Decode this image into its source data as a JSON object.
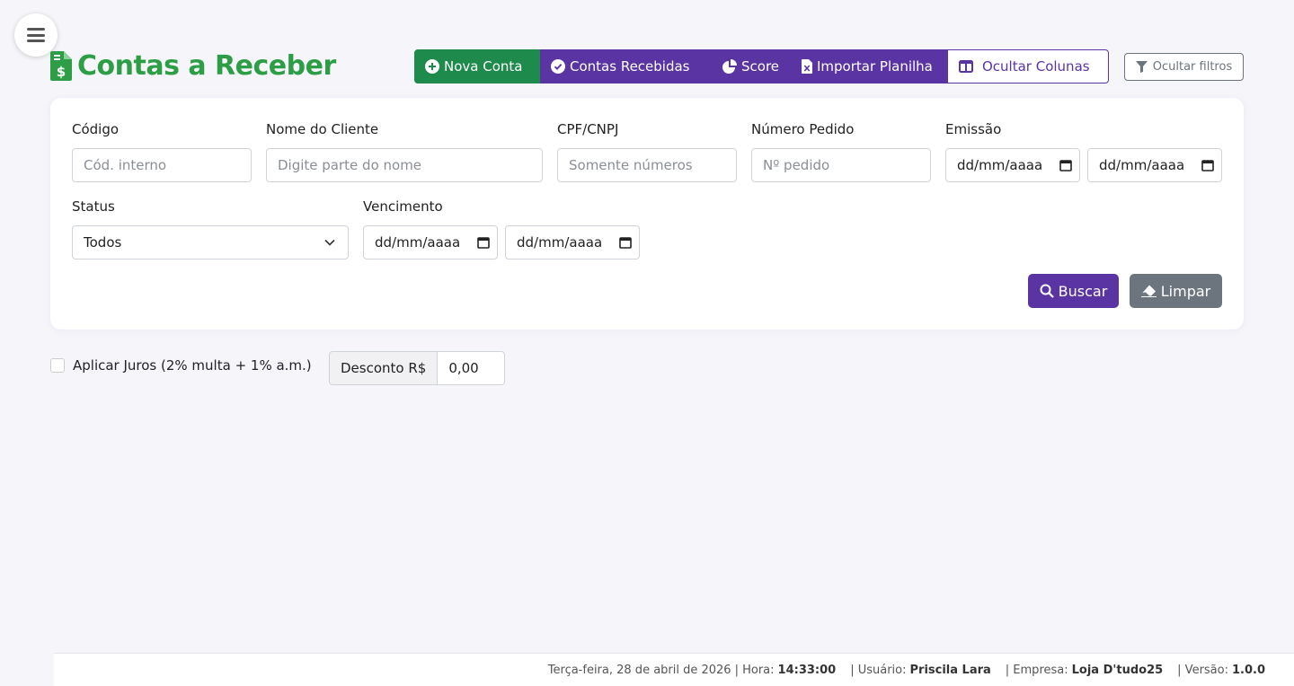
{
  "page": {
    "title": "Contas a Receber",
    "colors": {
      "green": "#2e9e46",
      "purple": "#5b34a3",
      "gray": "#6c757d"
    }
  },
  "toolbar": {
    "nova_conta": "Nova Conta",
    "contas_recebidas": "Contas Recebidas",
    "score": "Score",
    "importar_planilha": "Importar Planilha",
    "ocultar_colunas": "Ocultar Colunas",
    "ocultar_filtros": "Ocultar filtros"
  },
  "filters": {
    "codigo": {
      "label": "Código",
      "placeholder": "Cód. interno"
    },
    "nome_cliente": {
      "label": "Nome do Cliente",
      "placeholder": "Digite parte do nome"
    },
    "cpf_cnpj": {
      "label": "CPF/CNPJ",
      "placeholder": "Somente números"
    },
    "numero_pedido": {
      "label": "Número Pedido",
      "placeholder": "Nº pedido"
    },
    "emissao": {
      "label": "Emissão",
      "from": "dd/mm/aaaa",
      "to": "dd/mm/aaaa"
    },
    "status": {
      "label": "Status",
      "selected": "Todos"
    },
    "vencimento": {
      "label": "Vencimento",
      "from": "dd/mm/aaaa",
      "to": "dd/mm/aaaa"
    },
    "buscar": "Buscar",
    "limpar": "Limpar"
  },
  "extras": {
    "aplicar_juros": "Aplicar Juros (2% multa + 1% a.m.)",
    "desconto_label": "Desconto R$",
    "desconto_value": "0,00"
  },
  "footer": {
    "date": "Terça-feira, 28 de abril de 2026",
    "hora_label": "| Hora:",
    "hora": "14:33:00",
    "usuario_label": "| Usuário:",
    "usuario": "Priscila Lara",
    "empresa_label": "| Empresa:",
    "empresa": "Loja D'tudo25",
    "versao_label": "| Versão:",
    "versao": "1.0.0"
  },
  "icons": [
    "menu-icon",
    "file-invoice-dollar-icon",
    "plus-circle-icon",
    "check-circle-icon",
    "pie-chart-icon",
    "file-excel-icon",
    "columns-icon",
    "filter-icon",
    "calendar-icon",
    "chevron-down-icon",
    "search-icon",
    "eraser-icon"
  ]
}
